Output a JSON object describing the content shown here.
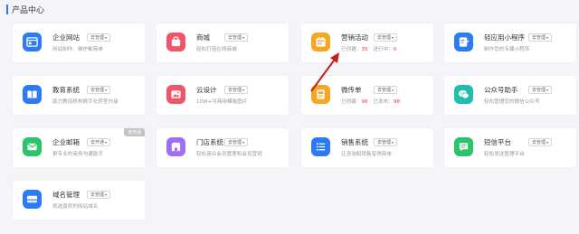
{
  "section": {
    "title": "产品中心"
  },
  "colors": {
    "accent": "#2d7bf4",
    "highlight": "#e33333",
    "arrow": "#c81e1e"
  },
  "products": [
    {
      "name": "企业网站",
      "button": "去管理",
      "desc": "网站制作，维护都简单",
      "icon": "website-icon",
      "color": "#2d7bf4"
    },
    {
      "name": "商城",
      "button": "去管理",
      "desc": "轻松打造在线商城",
      "icon": "shop-icon",
      "color": "#f0566a"
    },
    {
      "name": "营销活动",
      "button": "去管理",
      "desc_label1": "已创建：",
      "desc_value1": "35",
      "desc_label2": "进行中：",
      "desc_value2": "0",
      "icon": "calendar-icon",
      "color": "#f5a623"
    },
    {
      "name": "轻应用小程序",
      "button": "去管理",
      "desc": "制作您的专属小程序",
      "icon": "miniapp-icon",
      "color": "#2d7bf4"
    },
    {
      "name": "教育系统",
      "button": "去管理",
      "desc": "助力教培机构数字化转型升级",
      "icon": "book-icon",
      "color": "#2d7bf4"
    },
    {
      "name": "云设计",
      "button": "去管理",
      "desc": "10W+可商用模板图片",
      "icon": "image-icon",
      "color": "#f0566a"
    },
    {
      "name": "微传单",
      "button": "去管理",
      "desc_label1": "已创建：",
      "desc_value1": "98",
      "desc_label2": "已发布：",
      "desc_value2": "98",
      "icon": "flyer-icon",
      "color": "#f5a623"
    },
    {
      "name": "公众号助手",
      "button": "去管理",
      "desc": "轻松管理您的微信公众号",
      "icon": "wechat-icon",
      "color": "#1fbfae"
    },
    {
      "name": "企业邮箱",
      "button": "去开通",
      "desc": "更专业的商务沟通助手",
      "icon": "mail-icon",
      "color": "#2bc46a",
      "badge": "未开通"
    },
    {
      "name": "门店系统",
      "button": "去管理",
      "desc": "轻松商业会员管理和会员营销",
      "icon": "store-icon",
      "color": "#a06ef5"
    },
    {
      "name": "销售系统",
      "button": "去管理",
      "desc": "让咨询和销售变得简单",
      "icon": "list-icon",
      "color": "#2d7bf4"
    },
    {
      "name": "短信平台",
      "button": "去管理",
      "desc": "轻松发送管理平台",
      "icon": "sms-icon",
      "color": "#2bc46a"
    },
    {
      "name": "域名管理",
      "button": "去管理",
      "desc": "挑选喜欢的网站域名",
      "icon": "domain-icon",
      "color": "#2d7bf4"
    }
  ]
}
